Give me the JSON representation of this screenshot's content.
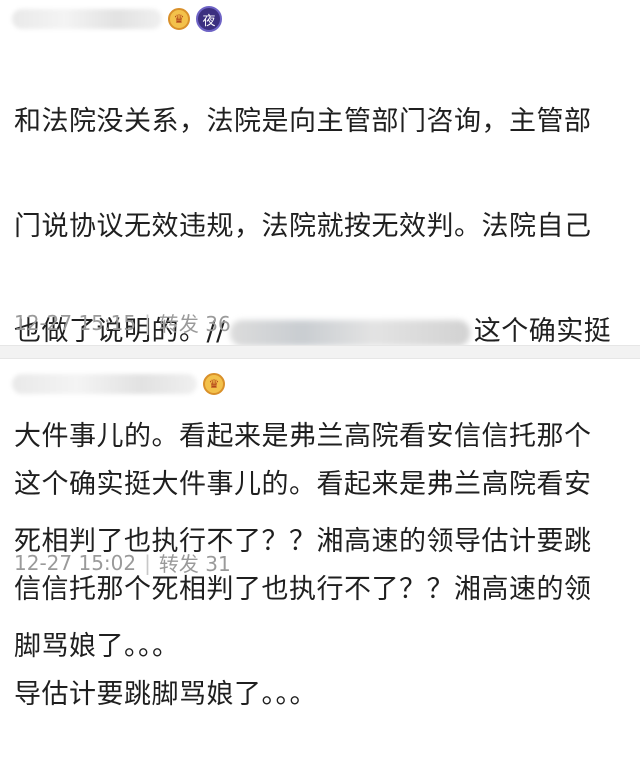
{
  "posts": [
    {
      "badge_icon": "night-badge-icon",
      "badge_text": "夜",
      "lines": [
        "和法院没关系，法院是向主管部门咨询，主管部",
        "门说协议无效违规，法院就按无效判。法院自己",
        "也做了说明的。//",
        "这个确实挺",
        "大件事儿的。看起来是弗兰高院看安信信托那个",
        "死相判了也执行不了？？湘高速的领导估计要跳",
        "脚骂娘了。。。"
      ],
      "time": "12-27 15:15",
      "separator": "|",
      "repost_label": "转发",
      "repost_count": "36"
    },
    {
      "badge_icon": "vip-crown-icon",
      "badge_text": "♛",
      "lines": [
        "这个确实挺大件事儿的。看起来是弗兰高院看安",
        "信信托那个死相判了也执行不了？？湘高速的领",
        "导估计要跳脚骂娘了。。。"
      ],
      "time": "12-27 15:02",
      "separator": "|",
      "repost_label": "转发",
      "repost_count": "31"
    }
  ]
}
